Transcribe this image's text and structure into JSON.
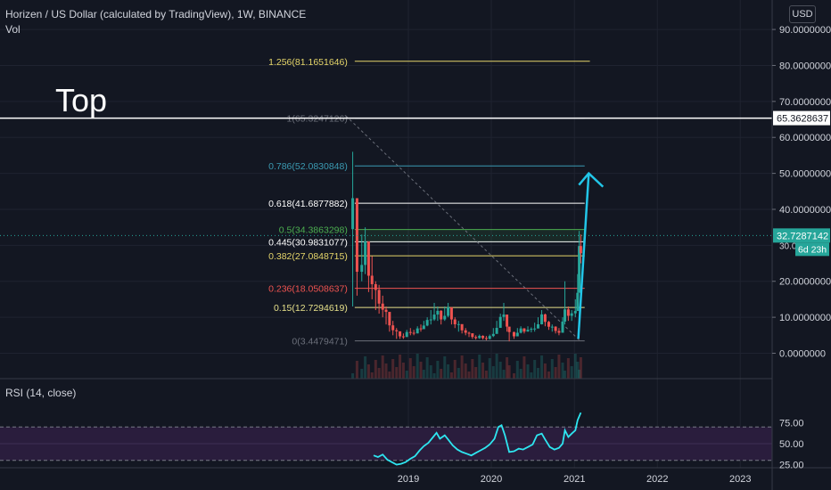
{
  "header": {
    "title": "Horizen / US Dollar (calculated by TradingView), 1W, BINANCE",
    "volume_label": "Vol",
    "currency_button": "USD"
  },
  "annotation": {
    "top_label": "Top"
  },
  "price_axis": {
    "ticks": [
      "90.0000000",
      "80.0000000",
      "70.0000000",
      "60.0000000",
      "50.0000000",
      "40.0000000",
      "20.0000000",
      "10.0000000",
      "0.0000000"
    ],
    "tick_values": [
      90,
      80,
      70,
      60,
      50,
      40,
      20,
      10,
      0
    ],
    "last_price": "32.7287142",
    "last_price_value": 32.7287142,
    "countdown": "6d 23h",
    "hline_label": "65.3628637",
    "hline_value": 65.3628637,
    "partial_tick": "30.0"
  },
  "rsi": {
    "title": "RSI (14, close)",
    "ticks": [
      "75.00",
      "50.00",
      "25.00"
    ],
    "tick_values": [
      75,
      50,
      25
    ],
    "upper_band": 70,
    "lower_band": 30
  },
  "time_axis": {
    "labels": [
      "2019",
      "2020",
      "2021",
      "2022",
      "2023"
    ]
  },
  "colors": {
    "background": "#131722",
    "up": "#26a69a",
    "down": "#ef5350",
    "rsi_line": "#2ee6f0",
    "rsi_band": "#2a1d3d",
    "arrow": "#22c6e8",
    "last_price_bg": "#26a69a"
  },
  "chart_data": [
    {
      "type": "candlestick",
      "title": "Horizen / US Dollar (calculated by TradingView), 1W, BINANCE",
      "ylim": [
        -3,
        98
      ],
      "x_range": [
        "2018-05",
        "2023-09"
      ],
      "fib_levels": [
        {
          "label": "1.256(81.1651646)",
          "value": 81.1651646,
          "color": "#e6d66a"
        },
        {
          "label": "1(65.3247126)",
          "value": 65.3247126,
          "color": "#6b6f7a"
        },
        {
          "label": "0.786(52.0830848)",
          "value": 52.0830848,
          "color": "#3b9ab2"
        },
        {
          "label": "0.618(41.6877882)",
          "value": 41.6877882,
          "color": "#ffffff"
        },
        {
          "label": "0.5(34.3863298)",
          "value": 34.3863298,
          "color": "#4caf50"
        },
        {
          "label": "0.445(30.9831077)",
          "value": 30.9831077,
          "color": "#ffffff"
        },
        {
          "label": "0.382(27.0848715)",
          "value": 27.0848715,
          "color": "#e6d66a"
        },
        {
          "label": "0.236(18.0508637)",
          "value": 18.0508637,
          "color": "#ef5350"
        },
        {
          "label": "0.15(12.7294619)",
          "value": 12.7294619,
          "color": "#e6e08a"
        },
        {
          "label": "0(3.4479471)",
          "value": 3.4479471,
          "color": "#6b6f7a"
        }
      ],
      "series": [
        {
          "values": [
            [
              "2018-05-01",
              56,
              13
            ],
            [
              "2018-05-20",
              35,
              16
            ],
            [
              "2018-06-10",
              33,
              20
            ],
            [
              "2018-06-25",
              35,
              22
            ],
            [
              "2018-07-10",
              30,
              17
            ],
            [
              "2018-07-25",
              27,
              15
            ],
            [
              "2018-08-10",
              20,
              12
            ],
            [
              "2018-08-25",
              19,
              11
            ],
            [
              "2018-09-10",
              16,
              10
            ],
            [
              "2018-09-25",
              13,
              8
            ],
            [
              "2018-10-10",
              11,
              6
            ],
            [
              "2018-10-25",
              9,
              5
            ],
            [
              "2018-11-10",
              7,
              4
            ],
            [
              "2018-11-25",
              6,
              4
            ],
            [
              "2018-12-10",
              5.5,
              4
            ],
            [
              "2018-12-25",
              6.5,
              4.5
            ],
            [
              "2019-01-10",
              7,
              5
            ],
            [
              "2019-01-25",
              6.5,
              5
            ],
            [
              "2019-02-10",
              7.5,
              5.5
            ],
            [
              "2019-02-25",
              8,
              6
            ],
            [
              "2019-03-10",
              9,
              7
            ],
            [
              "2019-03-25",
              10,
              7.5
            ],
            [
              "2019-04-10",
              12,
              8
            ],
            [
              "2019-04-25",
              14,
              9
            ],
            [
              "2019-05-10",
              13,
              9
            ],
            [
              "2019-05-25",
              12,
              8
            ],
            [
              "2019-06-10",
              13,
              9
            ],
            [
              "2019-06-25",
              14,
              10
            ],
            [
              "2019-07-10",
              12,
              8
            ],
            [
              "2019-07-25",
              10,
              7
            ],
            [
              "2019-08-10",
              9,
              6
            ],
            [
              "2019-08-25",
              8,
              5.5
            ],
            [
              "2019-09-10",
              7,
              5
            ],
            [
              "2019-09-25",
              6,
              4.5
            ],
            [
              "2019-10-10",
              5.5,
              4
            ],
            [
              "2019-10-25",
              5,
              3.8
            ],
            [
              "2019-11-10",
              5.2,
              4
            ],
            [
              "2019-11-25",
              5,
              3.8
            ],
            [
              "2019-12-10",
              4.8,
              3.6
            ],
            [
              "2019-12-25",
              5.2,
              3.8
            ],
            [
              "2020-01-10",
              7,
              4.5
            ],
            [
              "2020-01-25",
              9,
              6
            ],
            [
              "2020-02-10",
              11,
              8
            ],
            [
              "2020-02-25",
              14,
              9
            ],
            [
              "2020-03-10",
              10,
              6
            ],
            [
              "2020-03-20",
              7,
              3.3
            ],
            [
              "2020-04-10",
              6,
              4
            ],
            [
              "2020-04-25",
              7,
              5
            ],
            [
              "2020-05-10",
              7.5,
              5.5
            ],
            [
              "2020-05-25",
              7,
              5.5
            ],
            [
              "2020-06-10",
              7.5,
              6
            ],
            [
              "2020-06-25",
              7.2,
              5.8
            ],
            [
              "2020-07-10",
              8.5,
              6
            ],
            [
              "2020-07-25",
              10,
              7
            ],
            [
              "2020-08-10",
              12,
              8
            ],
            [
              "2020-08-25",
              11,
              7.5
            ],
            [
              "2020-09-10",
              9,
              6.5
            ],
            [
              "2020-09-25",
              8,
              6
            ],
            [
              "2020-10-10",
              7.5,
              5.5
            ],
            [
              "2020-10-25",
              7,
              5
            ],
            [
              "2020-11-10",
              10,
              6
            ],
            [
              "2020-11-20",
              20,
              8
            ],
            [
              "2020-12-05",
              13,
              9
            ],
            [
              "2020-12-20",
              12,
              9
            ],
            [
              "2021-01-05",
              15,
              10
            ],
            [
              "2021-01-15",
              22,
              14
            ],
            [
              "2021-01-22",
              34,
              20
            ],
            [
              "2021-01-29",
              33,
              25
            ]
          ]
        }
      ]
    },
    {
      "type": "line",
      "title": "RSI (14, close)",
      "ylim": [
        20,
        90
      ],
      "bands": [
        30,
        70
      ],
      "series": [
        {
          "values": [
            [
              "2018-08-01",
              36
            ],
            [
              "2018-08-20",
              34
            ],
            [
              "2018-09-10",
              37
            ],
            [
              "2018-09-30",
              31
            ],
            [
              "2018-10-20",
              28
            ],
            [
              "2018-11-10",
              25
            ],
            [
              "2018-11-30",
              26
            ],
            [
              "2018-12-20",
              28
            ],
            [
              "2019-01-10",
              32
            ],
            [
              "2019-01-30",
              35
            ],
            [
              "2019-02-20",
              42
            ],
            [
              "2019-03-10",
              47
            ],
            [
              "2019-03-30",
              51
            ],
            [
              "2019-04-20",
              58
            ],
            [
              "2019-05-05",
              63
            ],
            [
              "2019-05-20",
              56
            ],
            [
              "2019-06-10",
              60
            ],
            [
              "2019-06-25",
              55
            ],
            [
              "2019-07-15",
              48
            ],
            [
              "2019-08-05",
              43
            ],
            [
              "2019-08-25",
              40
            ],
            [
              "2019-09-15",
              38
            ],
            [
              "2019-10-05",
              36
            ],
            [
              "2019-10-25",
              39
            ],
            [
              "2019-11-15",
              42
            ],
            [
              "2019-12-05",
              45
            ],
            [
              "2019-12-25",
              49
            ],
            [
              "2020-01-15",
              56
            ],
            [
              "2020-02-01",
              70
            ],
            [
              "2020-02-15",
              72
            ],
            [
              "2020-03-01",
              60
            ],
            [
              "2020-03-20",
              40
            ],
            [
              "2020-04-10",
              41
            ],
            [
              "2020-05-01",
              44
            ],
            [
              "2020-05-20",
              43
            ],
            [
              "2020-06-10",
              46
            ],
            [
              "2020-07-01",
              49
            ],
            [
              "2020-07-20",
              60
            ],
            [
              "2020-08-10",
              62
            ],
            [
              "2020-08-25",
              55
            ],
            [
              "2020-09-15",
              46
            ],
            [
              "2020-10-05",
              43
            ],
            [
              "2020-10-25",
              45
            ],
            [
              "2020-11-10",
              50
            ],
            [
              "2020-11-20",
              66
            ],
            [
              "2020-12-05",
              58
            ],
            [
              "2020-12-20",
              62
            ],
            [
              "2021-01-05",
              66
            ],
            [
              "2021-01-15",
              78
            ],
            [
              "2021-01-29",
              87
            ]
          ]
        }
      ]
    }
  ]
}
